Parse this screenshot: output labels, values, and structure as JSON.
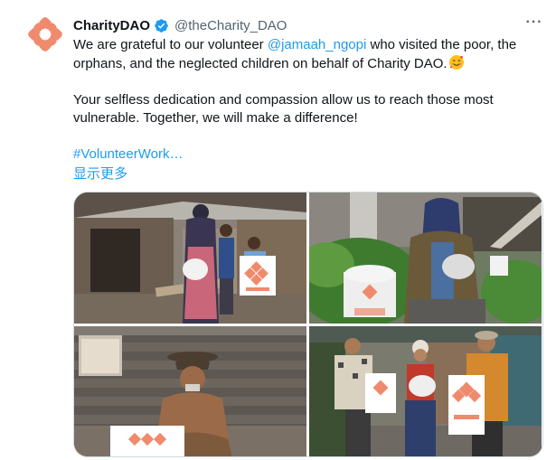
{
  "tweet": {
    "author_name": "CharityDAO",
    "author_handle": "@theCharity_DAO",
    "text_line1_prefix": "We are grateful to our volunteer ",
    "mention": "@jamaah_ngopi",
    "text_line1_suffix": " who visited the poor, the orphans, and the neglected children on behalf of Charity DAO.",
    "emoji": "smiling-face-with-hearts",
    "text_paragraph2": "Your selfless dedication and compassion allow us to reach those most vulnerable. Together, we will make a difference!",
    "hashtag": "#VolunteerWork…",
    "show_more": "显示更多",
    "more_menu": "···"
  },
  "icons": {
    "avatar": "charitydao-logo",
    "verified": "verified-badge-icon",
    "more": "more-options-icon"
  },
  "colors": {
    "link": "#1d9bf0",
    "verified": "#1d9bf0",
    "secondary_text": "#536471",
    "brand_orange": "#f08a6c"
  },
  "media": {
    "count": 4
  }
}
